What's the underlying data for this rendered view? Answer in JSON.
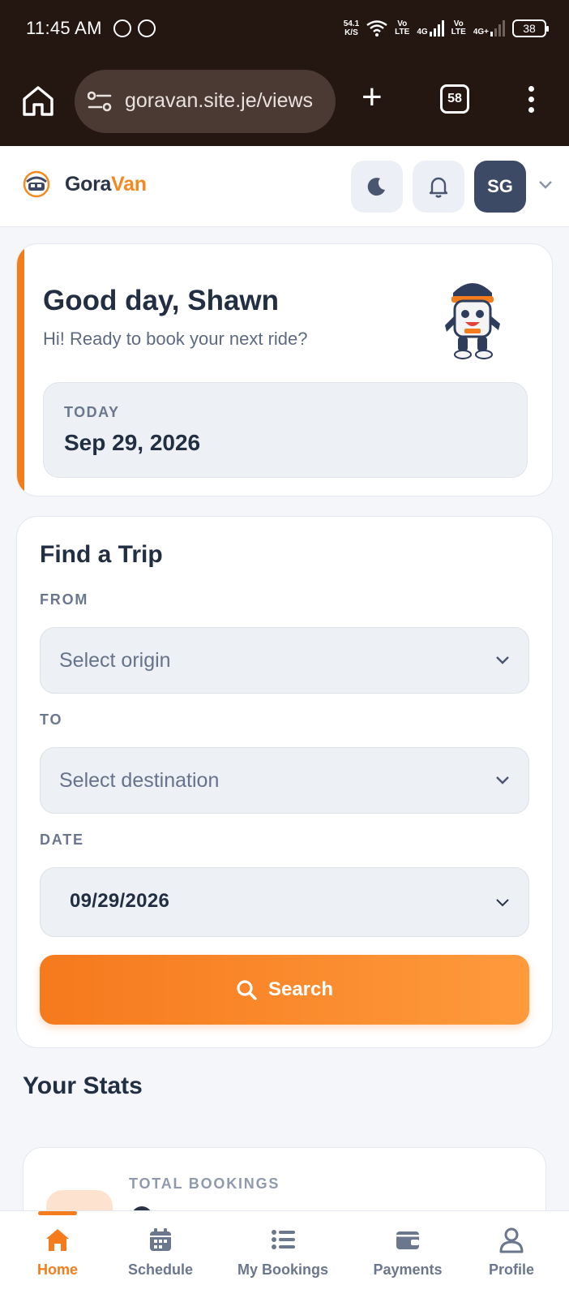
{
  "status_bar": {
    "time": "11:45 AM",
    "net_speed_value": "54.1",
    "net_speed_unit": "K/S",
    "volte1": "Vo\nLTE",
    "net1": "4G",
    "volte2": "Vo\nLTE",
    "net2": "4G+",
    "battery": "38"
  },
  "browser": {
    "url": "goravan.site.je/views",
    "tab_count": "58"
  },
  "header": {
    "brand_primary": "Gora",
    "brand_accent": "Van",
    "avatar_initials": "SG"
  },
  "greeting": {
    "title": "Good day, Shawn",
    "subtitle": "Hi! Ready to book your next ride?",
    "today_label": "TODAY",
    "today_date": "Sep 29, 2026"
  },
  "trip": {
    "title": "Find a Trip",
    "from_label": "FROM",
    "from_placeholder": "Select origin",
    "to_label": "TO",
    "to_placeholder": "Select destination",
    "date_label": "DATE",
    "date_value": "09/29/2026",
    "search_label": "Search"
  },
  "stats": {
    "title": "Your Stats",
    "total_bookings_label": "TOTAL BOOKINGS"
  },
  "nav": {
    "items": [
      {
        "label": "Home",
        "icon": "home-icon"
      },
      {
        "label": "Schedule",
        "icon": "calendar-icon"
      },
      {
        "label": "My Bookings",
        "icon": "list-icon"
      },
      {
        "label": "Payments",
        "icon": "wallet-icon"
      },
      {
        "label": "Profile",
        "icon": "user-icon"
      }
    ]
  },
  "colors": {
    "accent": "#f47c1c",
    "toolbar": "#241611",
    "avatar_bg": "#3d4a66"
  }
}
